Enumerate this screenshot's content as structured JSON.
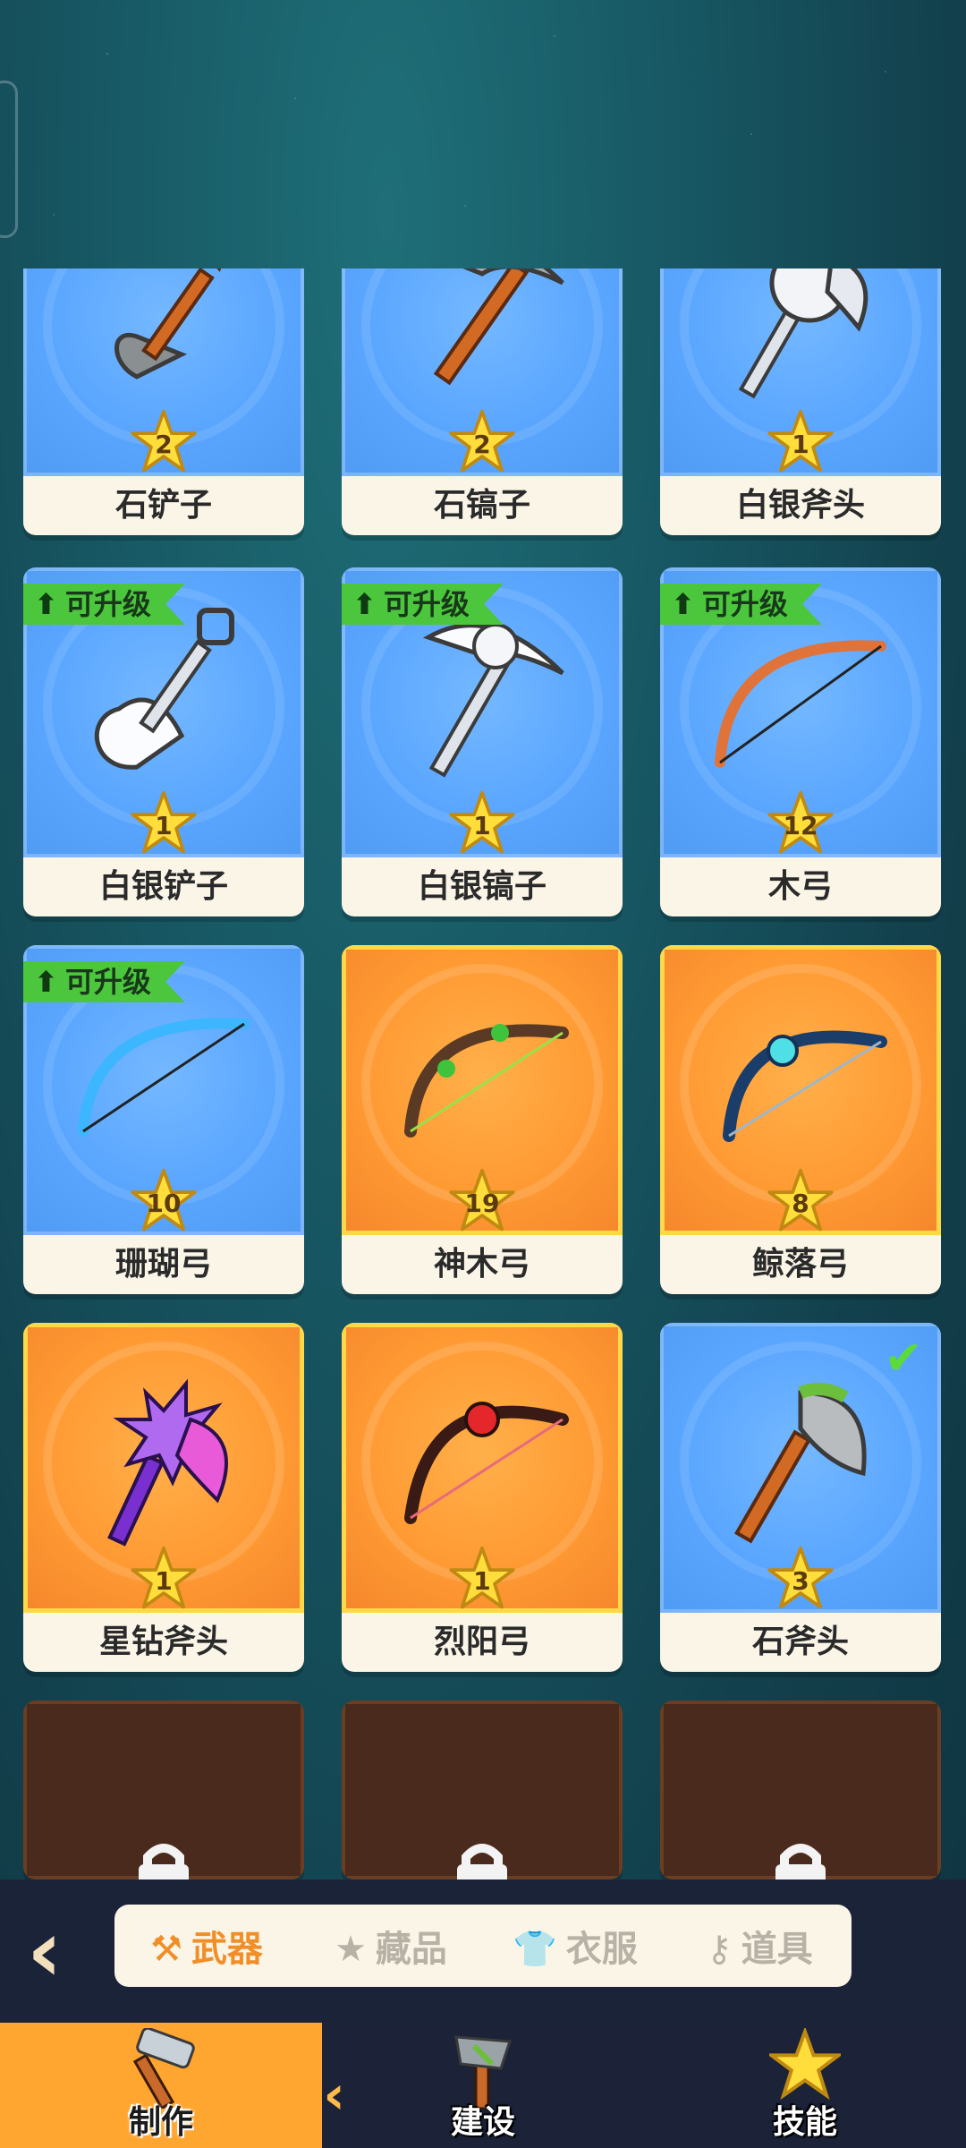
{
  "items": [
    {
      "name": "石铲子",
      "level": "2",
      "bg": "blue",
      "upgrade": false,
      "check": false,
      "icon": "stone-shovel-icon"
    },
    {
      "name": "石镐子",
      "level": "2",
      "bg": "blue",
      "upgrade": false,
      "check": false,
      "icon": "stone-pickaxe-icon"
    },
    {
      "name": "白银斧头",
      "level": "1",
      "bg": "blue",
      "upgrade": false,
      "check": false,
      "icon": "silver-axe-icon"
    },
    {
      "name": "白银铲子",
      "level": "1",
      "bg": "blue",
      "upgrade": true,
      "check": false,
      "icon": "silver-shovel-icon"
    },
    {
      "name": "白银镐子",
      "level": "1",
      "bg": "blue",
      "upgrade": true,
      "check": false,
      "icon": "silver-pickaxe-icon"
    },
    {
      "name": "木弓",
      "level": "12",
      "bg": "blue",
      "upgrade": true,
      "check": false,
      "icon": "wood-bow-icon"
    },
    {
      "name": "珊瑚弓",
      "level": "10",
      "bg": "blue",
      "upgrade": true,
      "check": false,
      "icon": "coral-bow-icon"
    },
    {
      "name": "神木弓",
      "level": "19",
      "bg": "orange",
      "upgrade": false,
      "check": false,
      "icon": "divine-wood-bow-icon"
    },
    {
      "name": "鲸落弓",
      "level": "8",
      "bg": "orange",
      "upgrade": false,
      "check": false,
      "icon": "whale-bow-icon"
    },
    {
      "name": "星钻斧头",
      "level": "1",
      "bg": "orange",
      "upgrade": false,
      "check": false,
      "icon": "star-diamond-axe-icon"
    },
    {
      "name": "烈阳弓",
      "level": "1",
      "bg": "orange",
      "upgrade": false,
      "check": false,
      "icon": "sun-bow-icon"
    },
    {
      "name": "石斧头",
      "level": "3",
      "bg": "blue",
      "upgrade": false,
      "check": true,
      "icon": "stone-axe-icon"
    }
  ],
  "upgrade_label": "可升级",
  "locked_items": [
    {
      "icon": "lock-icon"
    },
    {
      "icon": "lock-icon"
    },
    {
      "icon": "lock-icon"
    }
  ],
  "categories": [
    {
      "label": "武器",
      "icon": "hammer-icon",
      "active": true
    },
    {
      "label": "藏品",
      "icon": "star-card-icon",
      "active": false
    },
    {
      "label": "衣服",
      "icon": "shirt-icon",
      "active": false
    },
    {
      "label": "道具",
      "icon": "key-icon",
      "active": false
    }
  ],
  "nav": [
    {
      "label": "制作",
      "icon": "hammer-icon",
      "active": true
    },
    {
      "label": "建设",
      "icon": "stone-hammer-icon",
      "active": false
    },
    {
      "label": "技能",
      "icon": "star-icon",
      "active": false
    }
  ],
  "colors": {
    "blue_card": "#5aa6ff",
    "orange_card": "#ff9a33",
    "badge_green": "#4cc63c",
    "active_tab": "#ffa631",
    "nav_bg": "#1c2338"
  }
}
